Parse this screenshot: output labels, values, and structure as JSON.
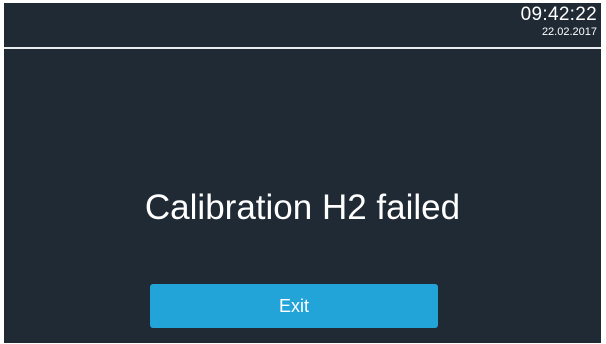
{
  "header": {
    "time": "09:42:22",
    "date": "22.02.2017"
  },
  "main": {
    "message": "Calibration H2 failed",
    "exit_label": "Exit"
  },
  "colors": {
    "background": "#202a35",
    "divider": "#e9ecef",
    "text": "#ffffff",
    "accent_button": "#22a4d9"
  }
}
